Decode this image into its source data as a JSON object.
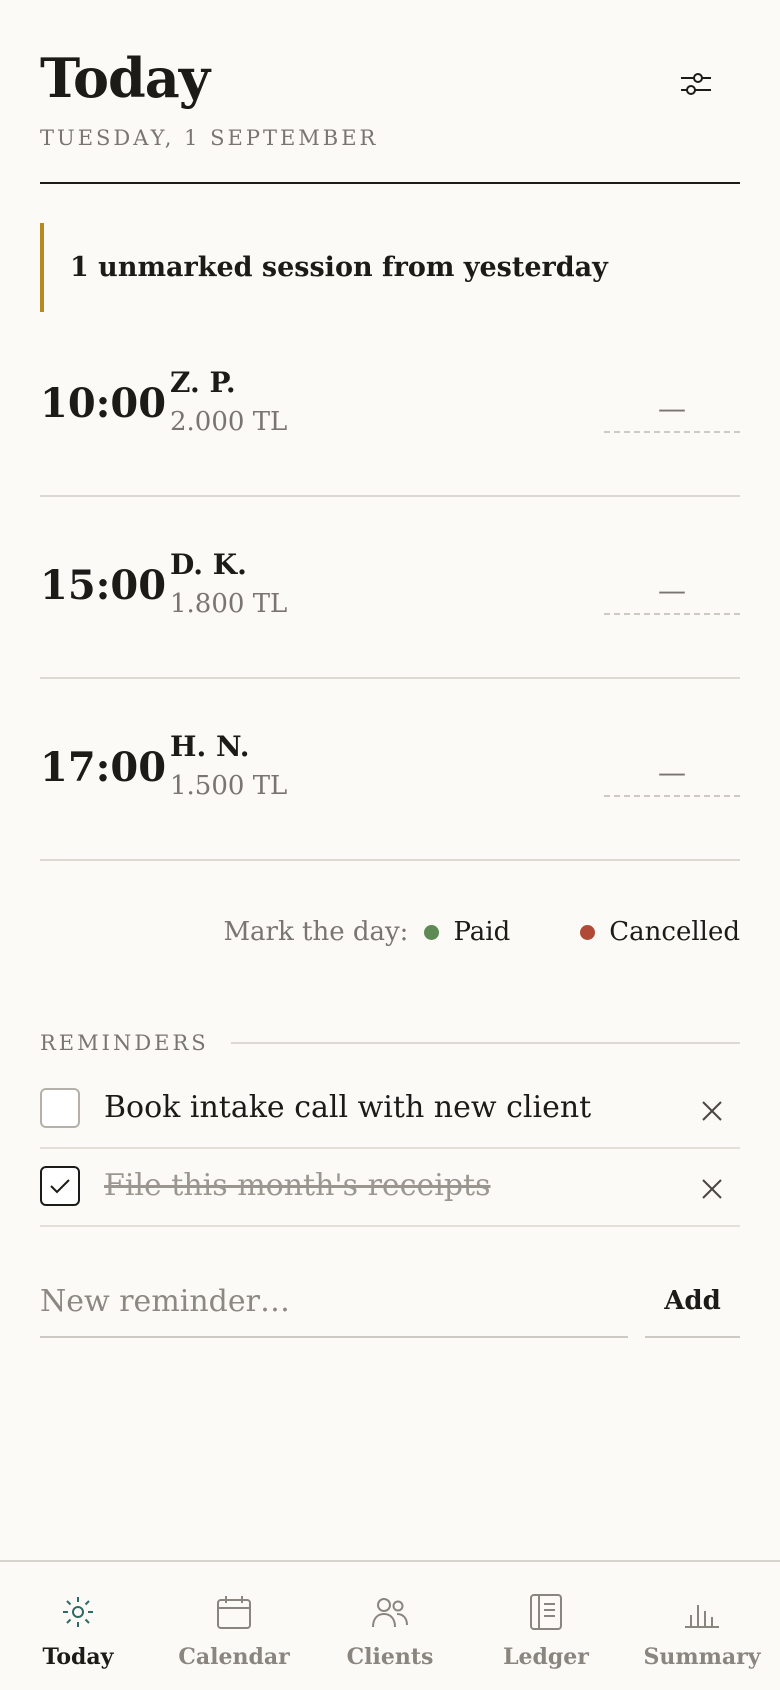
{
  "header": {
    "title": "Today",
    "date": "TUESDAY, 1 SEPTEMBER",
    "filter_icon": "sliders-icon"
  },
  "alert": {
    "text": "1 unmarked session from yesterday"
  },
  "sessions": [
    {
      "time": "10:00",
      "client": "Z. P.",
      "fee": "2.000 TL",
      "status": "—"
    },
    {
      "time": "15:00",
      "client": "D. K.",
      "fee": "1.800 TL",
      "status": "—"
    },
    {
      "time": "17:00",
      "client": "H. N.",
      "fee": "1.500 TL",
      "status": "—"
    }
  ],
  "mark_day": {
    "label": "Mark the day:",
    "paid_label": "Paid",
    "cancelled_label": "Cancelled",
    "paid_color": "#5e8a55",
    "cancelled_color": "#b04a37"
  },
  "reminders": {
    "heading": "REMINDERS",
    "items": [
      {
        "text": "Book intake call with new client",
        "checked": false
      },
      {
        "text": "File this month's receipts",
        "checked": true
      }
    ],
    "new_placeholder": "New reminder…",
    "add_label": "Add"
  },
  "tabs": [
    {
      "label": "Today",
      "icon": "sun-icon",
      "active": true
    },
    {
      "label": "Calendar",
      "icon": "calendar-icon",
      "active": false
    },
    {
      "label": "Clients",
      "icon": "users-icon",
      "active": false
    },
    {
      "label": "Ledger",
      "icon": "ledger-icon",
      "active": false
    },
    {
      "label": "Summary",
      "icon": "bar-chart-icon",
      "active": false
    }
  ],
  "colors": {
    "accent_bar": "#b58a1e",
    "active_tab_icon": "#2f6b63",
    "text": "#1d1b18",
    "muted": "#7a7570"
  }
}
